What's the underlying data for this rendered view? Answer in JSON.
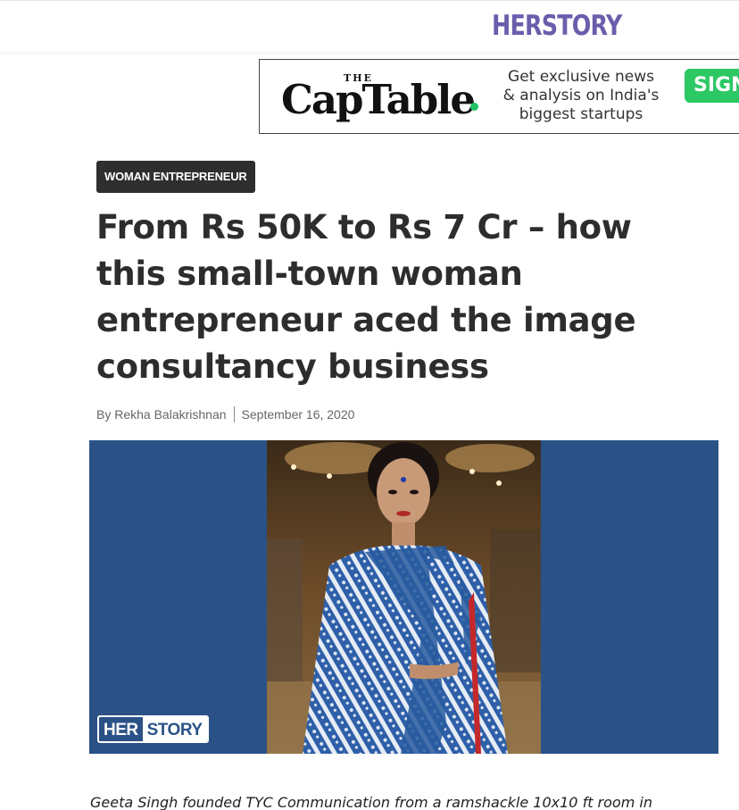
{
  "header": {
    "brand": "HERSTORY"
  },
  "ad": {
    "logo_the": "THE",
    "logo_name": "CapTable",
    "tagline": "Get exclusive news & analysis on India's biggest startups",
    "cta": "SIGN",
    "accent_color": "#2cc864"
  },
  "article": {
    "category": "WOMAN ENTREPRENEUR",
    "headline": "From Rs 50K to Rs 7 Cr – how this small-town woman entrepreneur aced the image consultancy business",
    "author": "By Rekha Balakrishnan",
    "date": "September 16, 2020",
    "hero_watermark_left": "HER",
    "hero_watermark_right": "STORY",
    "summary": "Geeta Singh founded TYC Communication from a ramshackle 10x10 ft room in"
  },
  "colors": {
    "brand": "#6c5dac",
    "hero_background": "#2a5286",
    "category_bg": "#2e2e2e"
  }
}
